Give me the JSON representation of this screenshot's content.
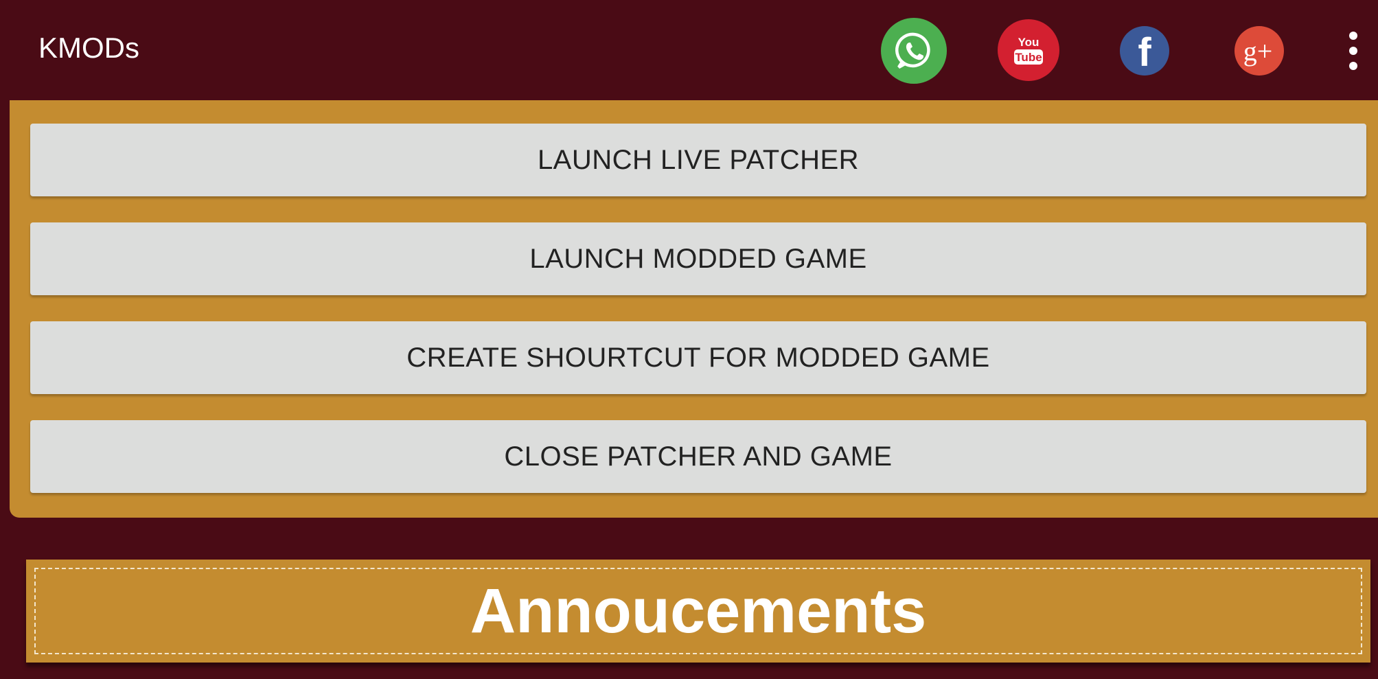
{
  "appbar": {
    "title": "KMODs",
    "icons": [
      "whatsapp-icon",
      "youtube-icon",
      "facebook-icon",
      "google-plus-icon",
      "more-vert-icon"
    ],
    "youtube_text_top": "You",
    "youtube_text_bottom": "Tube",
    "facebook_glyph": "f",
    "google_plus_glyph": "g+"
  },
  "actions": {
    "launch_live_patcher": "LAUNCH LIVE PATCHER",
    "launch_modded_game": "LAUNCH MODDED GAME",
    "create_shortcut": "CREATE SHOURTCUT FOR MODDED GAME",
    "close_patcher": "CLOSE PATCHER AND GAME"
  },
  "announcements": {
    "title": "Annoucements"
  },
  "colors": {
    "background": "#4a0b15",
    "panel": "#c48c30",
    "button": "#dcdddc",
    "whatsapp": "#4caf50",
    "youtube": "#d32030",
    "facebook": "#3b5998",
    "google_plus": "#dd4b39"
  }
}
